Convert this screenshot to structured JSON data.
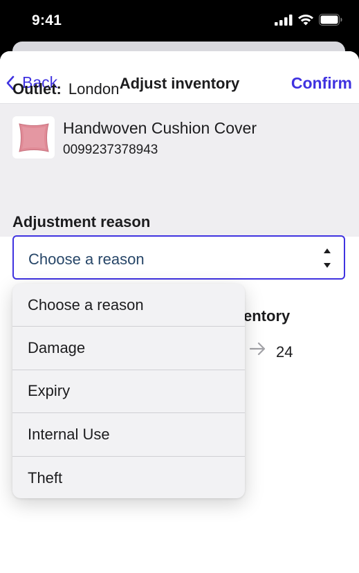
{
  "status_bar": {
    "time": "9:41"
  },
  "nav": {
    "back_label": "Back",
    "title": "Adjust inventory",
    "confirm_label": "Confirm"
  },
  "outlet": {
    "label": "Outlet:",
    "value": "London"
  },
  "product": {
    "name": "Handwoven Cushion Cover",
    "sku": "0099237378943"
  },
  "adjustment": {
    "label": "Adjustment reason",
    "selected": "Choose a reason"
  },
  "background": {
    "inventory_label_partial": "entory",
    "new_inventory_value": "24"
  },
  "dropdown": {
    "options": [
      "Choose a reason",
      "Damage",
      "Expiry",
      "Internal Use",
      "Theft"
    ]
  },
  "colors": {
    "accent": "#3f32e0",
    "panel_bg": "#efeef1",
    "select_text": "#274668"
  }
}
